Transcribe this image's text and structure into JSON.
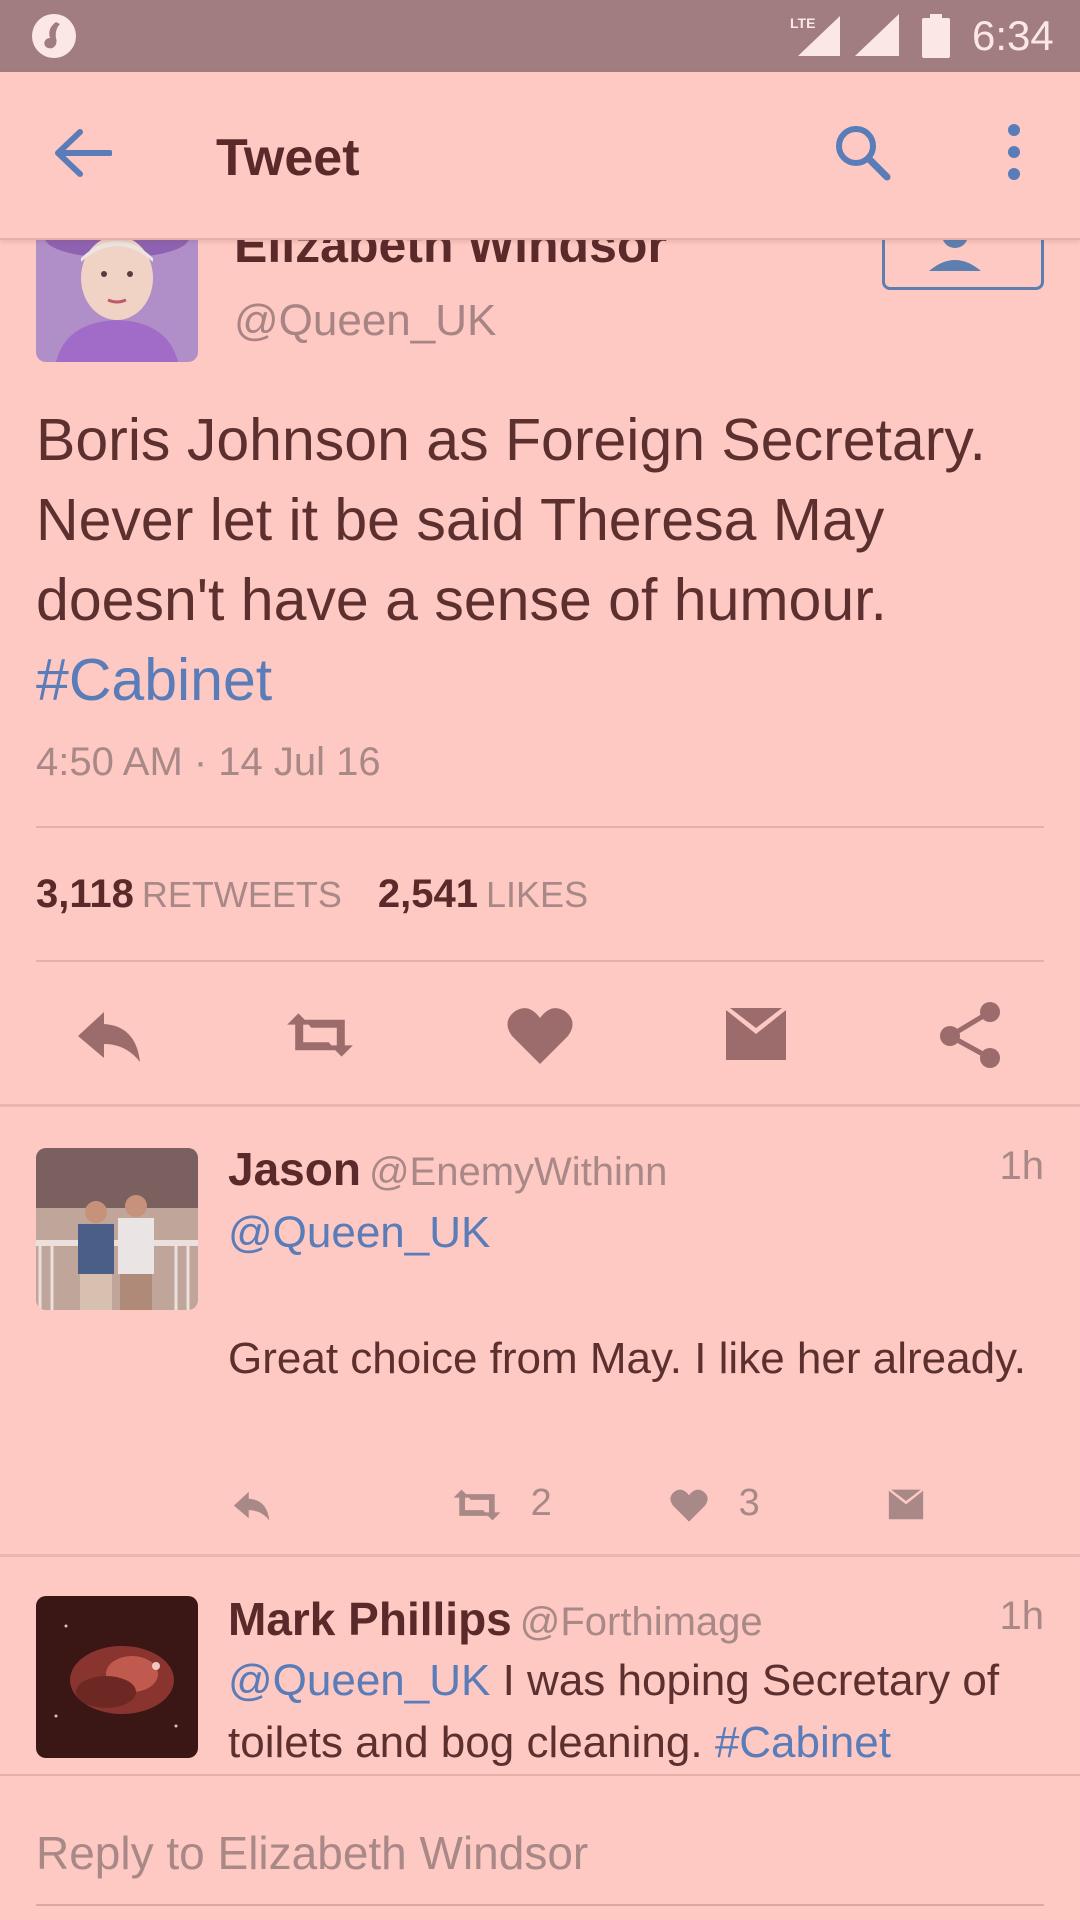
{
  "status_bar": {
    "time": "6:34",
    "network": "LTE",
    "left_icon": "music-app-icon"
  },
  "app_bar": {
    "title": "Tweet",
    "back_icon": "arrow-left-icon",
    "search_icon": "search-icon",
    "more_icon": "more-vertical-icon"
  },
  "tweet": {
    "author_name": "Elizabeth Windsor",
    "author_handle": "@Queen_UK",
    "text": "Boris Johnson as Foreign Secretary. Never let it be said Theresa May doesn't have a sense of humour.",
    "hashtag": "#Cabinet",
    "timestamp": "4:50 AM · 14 Jul 16",
    "retweets_count": "3,118",
    "retweets_label": "RETWEETS",
    "likes_count": "2,541",
    "likes_label": "LIKES"
  },
  "replies": [
    {
      "name": "Jason",
      "handle": "@EnemyWithinn",
      "time": "1h",
      "mention": "@Queen_UK",
      "text": "Great choice from May. I like her already.",
      "retweets": "2",
      "likes": "3"
    },
    {
      "name": "Mark Phillips",
      "handle": "@Forthimage",
      "time": "1h",
      "mention": "@Queen_UK",
      "text": "I was hoping Secretary of toilets and bog cleaning.",
      "hashtag": "#Cabinet"
    }
  ],
  "reply_box": {
    "placeholder": "Reply to Elizabeth Windsor"
  },
  "colors": {
    "background": "#fec9c2",
    "status_bar": "#a27d80",
    "accent_blue": "#5a7cb8",
    "icon_brown": "#9c6c6c"
  }
}
